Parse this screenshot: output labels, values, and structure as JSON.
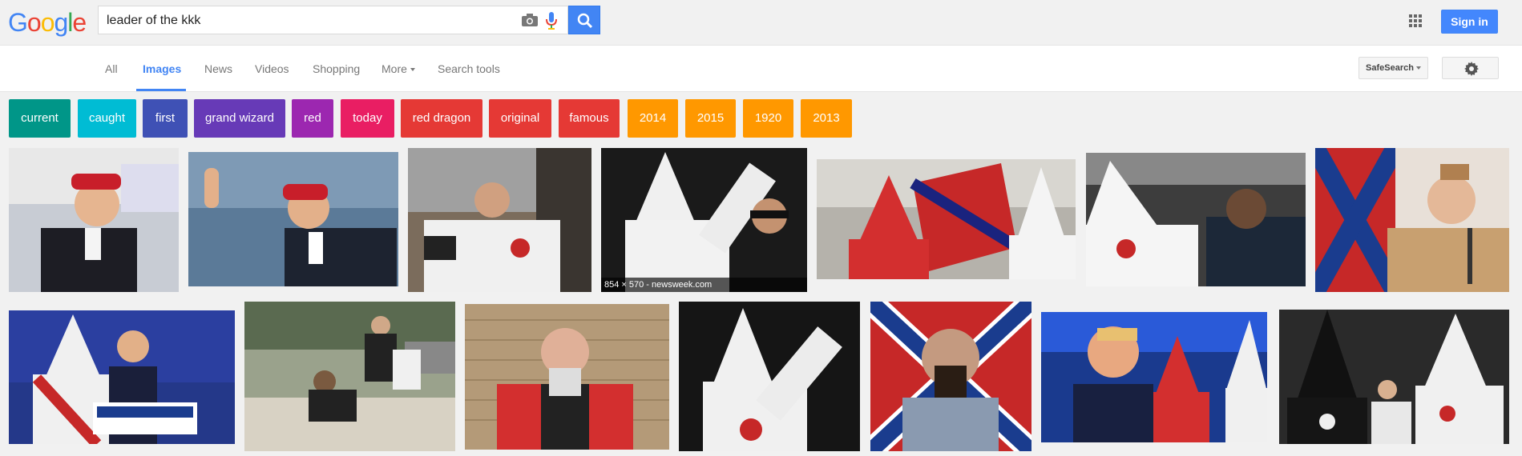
{
  "logo": {
    "letters": [
      "G",
      "o",
      "o",
      "g",
      "l",
      "e"
    ],
    "colors": [
      "#4285f4",
      "#ea4335",
      "#fbbc05",
      "#4285f4",
      "#34a853",
      "#ea4335"
    ]
  },
  "search": {
    "value": "leader of the kkk"
  },
  "header": {
    "signin_label": "Sign in",
    "apps_icon": "apps-grid-icon"
  },
  "tabs": [
    {
      "label": "All"
    },
    {
      "label": "Images"
    },
    {
      "label": "News"
    },
    {
      "label": "Videos"
    },
    {
      "label": "Shopping"
    },
    {
      "label": "More"
    },
    {
      "label": "Search tools"
    }
  ],
  "active_tab": "Images",
  "safesearch_label": "SafeSearch",
  "chips": [
    {
      "label": "current",
      "color": "#009688"
    },
    {
      "label": "caught",
      "color": "#00bcd4"
    },
    {
      "label": "first",
      "color": "#3f51b5"
    },
    {
      "label": "grand wizard",
      "color": "#673ab7"
    },
    {
      "label": "red",
      "color": "#9c27b0"
    },
    {
      "label": "today",
      "color": "#e91e63"
    },
    {
      "label": "red dragon",
      "color": "#e53935"
    },
    {
      "label": "original",
      "color": "#e53935"
    },
    {
      "label": "famous",
      "color": "#e53935"
    },
    {
      "label": "2014",
      "color": "#ff9800"
    },
    {
      "label": "2015",
      "color": "#ff9800"
    },
    {
      "label": "1920",
      "color": "#ff9800"
    },
    {
      "label": "2013",
      "color": "#ff9800"
    }
  ],
  "hovered_result_caption": "854 × 570 - newsweek.com"
}
